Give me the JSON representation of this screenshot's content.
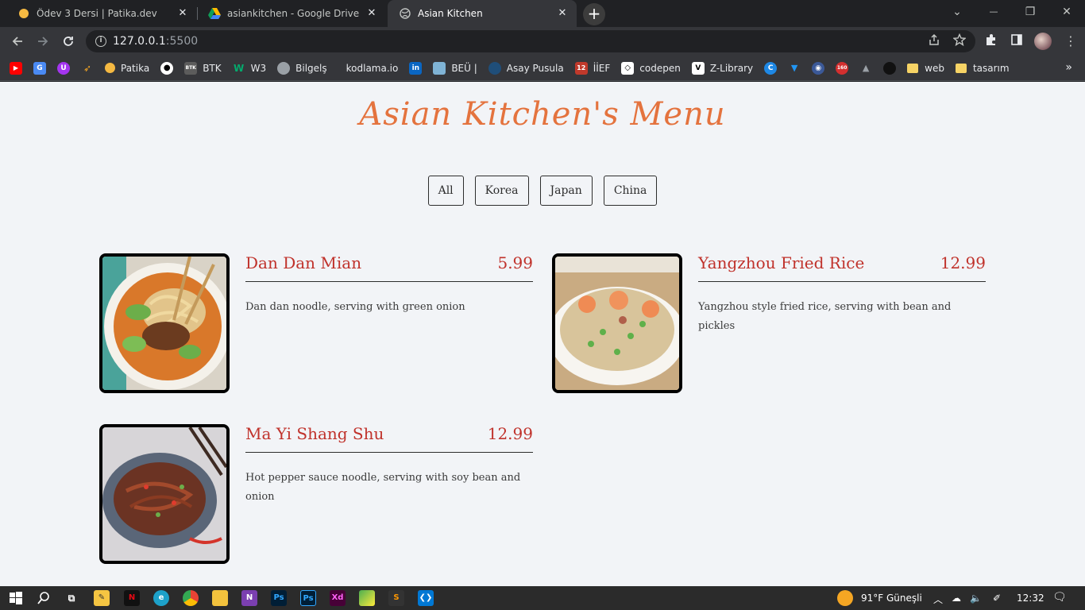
{
  "browser": {
    "tabs": [
      {
        "title": "Ödev 3 Dersi | Patika.dev",
        "close": "✕"
      },
      {
        "title": "asiankitchen - Google Drive",
        "close": "✕"
      },
      {
        "title": "Asian Kitchen",
        "close": "✕"
      }
    ],
    "new_tab": "+",
    "window_controls": {
      "tab_search": "⌄",
      "minimize": "—",
      "restore": "❐",
      "close": "✕"
    },
    "url": {
      "host": "127.0.0.1",
      "port": ":5500"
    },
    "icons": {
      "back": "arrow-left-icon",
      "forward": "arrow-right-icon",
      "reload": "reload-icon",
      "share": "share-icon",
      "star": "star-icon",
      "extensions": "puzzle-icon",
      "sidepanel": "sidepanel-icon"
    }
  },
  "bookmarks": [
    {
      "label": "",
      "icon": "youtube-icon",
      "color": "#ff0000",
      "glyph": "▶"
    },
    {
      "label": "",
      "icon": "translate-icon",
      "color": "#4a8af4",
      "glyph": "G"
    },
    {
      "label": "",
      "icon": "udemy-icon",
      "color": "#a435f0",
      "glyph": "U"
    },
    {
      "label": "",
      "icon": "rocket-icon",
      "color": "#35363a",
      "glyph": "🚀"
    },
    {
      "label": "Patika",
      "icon": "patika-icon",
      "color": "#f5b942",
      "glyph": ""
    },
    {
      "label": "",
      "icon": "github-icon",
      "color": "#ffffff",
      "glyph": ""
    },
    {
      "label": "BTK",
      "icon": "btk-icon",
      "color": "#5c5c5c",
      "glyph": "BTK"
    },
    {
      "label": "W3",
      "icon": "w3-icon",
      "color": "#04aa6d",
      "glyph": "W"
    },
    {
      "label": "Bilgelş",
      "icon": "globe-icon",
      "color": "#9aa0a6",
      "glyph": ""
    },
    {
      "label": "kodlama.io",
      "icon": "kodlama-icon",
      "color": "#35363a",
      "glyph": ""
    },
    {
      "label": "",
      "icon": "linkedin-icon",
      "color": "#0a66c2",
      "glyph": "in"
    },
    {
      "label": "BEÜ |",
      "icon": "beu-icon",
      "color": "#7fb3d5",
      "glyph": ""
    },
    {
      "label": "Asay Pusula",
      "icon": "pusula-icon",
      "color": "#1f4e79",
      "glyph": ""
    },
    {
      "label": "İİEF",
      "icon": "iief-icon",
      "color": "#c0392b",
      "glyph": "12"
    },
    {
      "label": "codepen",
      "icon": "codepen-icon",
      "color": "#ffffff",
      "glyph": ""
    },
    {
      "label": "Z-Library",
      "icon": "zlibrary-icon",
      "color": "#ffffff",
      "glyph": "V"
    },
    {
      "label": "",
      "icon": "c-icon",
      "color": "#1e88e5",
      "glyph": "C"
    },
    {
      "label": "",
      "icon": "vuetify-icon",
      "color": "#1867c0",
      "glyph": "▼"
    },
    {
      "label": "",
      "icon": "owl-icon",
      "color": "#3b5998",
      "glyph": "◉"
    },
    {
      "label": "",
      "icon": "160-icon",
      "color": "#d32f2f",
      "glyph": "160"
    },
    {
      "label": "",
      "icon": "cap-icon",
      "color": "#35363a",
      "glyph": "🎓"
    },
    {
      "label": "",
      "icon": "dark-icon",
      "color": "#111111",
      "glyph": ""
    },
    {
      "label": "web",
      "icon": "folder-icon",
      "color": "#f6d365",
      "glyph": ""
    },
    {
      "label": "tasarım",
      "icon": "folder-icon",
      "color": "#f6d365",
      "glyph": ""
    }
  ],
  "bookmarks_more": "»",
  "page": {
    "title": "Asian Kitchen's Menu",
    "filters": [
      "All",
      "Korea",
      "Japan",
      "China"
    ],
    "items": [
      {
        "name": "Dan Dan Mian",
        "price": "5.99",
        "desc": "Dan dan noodle, serving with green onion",
        "image": "dan-dan-noodle-photo"
      },
      {
        "name": "Yangzhou Fried Rice",
        "price": "12.99",
        "desc": "Yangzhou style fried rice, serving with bean and pickles",
        "image": "fried-rice-photo"
      },
      {
        "name": "Ma Yi Shang Shu",
        "price": "12.99",
        "desc": "Hot pepper sauce noodle, serving with soy bean and onion",
        "image": "glass-noodle-photo"
      }
    ],
    "colors": {
      "title": "#e4733e",
      "item_text": "#c0322b",
      "background": "#f2f4f7"
    }
  },
  "taskbar": {
    "weather": "91°F  Güneşli",
    "time": "12:32",
    "apps": [
      "start-icon",
      "search-icon",
      "taskview-icon",
      "notes-icon",
      "netflix-icon",
      "edge-icon",
      "chrome-icon",
      "explorer-icon",
      "onenote-icon",
      "photoshop-icon",
      "photoshop-icon",
      "xd-icon",
      "hotspot-icon",
      "sublime-icon",
      "vscode-icon"
    ]
  }
}
